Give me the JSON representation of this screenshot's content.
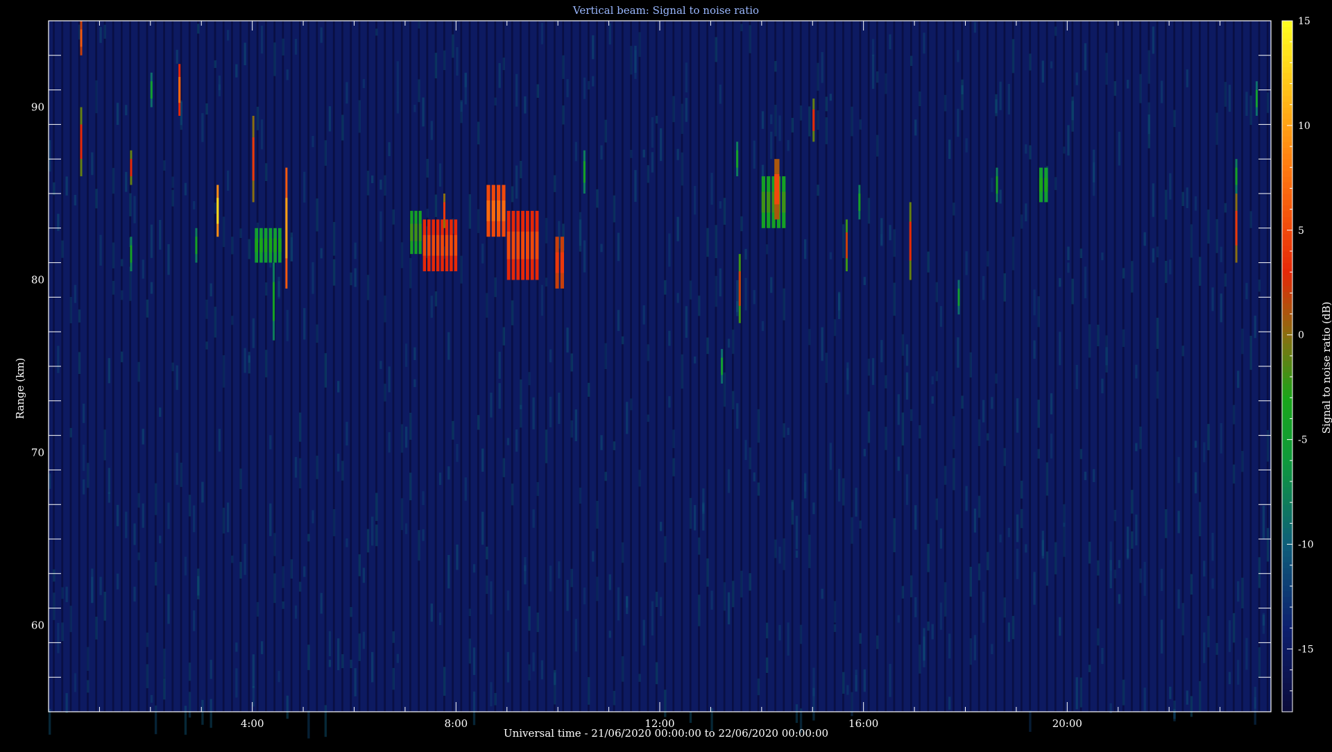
{
  "chart_data": {
    "type": "heatmap",
    "title": "Vertical beam: Signal to noise ratio",
    "xlabel": "Universal time - 21/06/2020 00:00:00 to 22/06/2020 00:00:00",
    "ylabel": "Range (km)",
    "colorbar_label": "Signal to noise ratio (dB)",
    "x_unit": "hours UT",
    "xlim": [
      0,
      24
    ],
    "ylim": [
      55,
      95
    ],
    "clim": [
      -18,
      15
    ],
    "x_ticks": [
      {
        "value": 4,
        "label": "4:00"
      },
      {
        "value": 8,
        "label": "8:00"
      },
      {
        "value": 12,
        "label": "12:00"
      },
      {
        "value": 16,
        "label": "16:00"
      },
      {
        "value": 20,
        "label": "20:00"
      }
    ],
    "y_ticks": [
      {
        "value": 60,
        "label": "60"
      },
      {
        "value": 70,
        "label": "70"
      },
      {
        "value": 80,
        "label": "80"
      },
      {
        "value": 90,
        "label": "90"
      }
    ],
    "colorbar_ticks": [
      {
        "value": 15,
        "label": "15"
      },
      {
        "value": 10,
        "label": "10"
      },
      {
        "value": 5,
        "label": "5"
      },
      {
        "value": 0,
        "label": "0"
      },
      {
        "value": -5,
        "label": "-5"
      },
      {
        "value": -10,
        "label": "-10"
      },
      {
        "value": -15,
        "label": "-15"
      }
    ],
    "colormap": [
      {
        "value": -18,
        "color": "#0b0b3a"
      },
      {
        "value": -14,
        "color": "#0d1f6e"
      },
      {
        "value": -10,
        "color": "#0e5e7a"
      },
      {
        "value": -6,
        "color": "#0f9a3c"
      },
      {
        "value": -3,
        "color": "#1aa51a"
      },
      {
        "value": 0,
        "color": "#8a6e10"
      },
      {
        "value": 3,
        "color": "#e62808"
      },
      {
        "value": 8,
        "color": "#ff7a10"
      },
      {
        "value": 15,
        "color": "#ffff20"
      }
    ],
    "echo_events": [
      {
        "t0": 0.62,
        "t1": 0.65,
        "r0": 86,
        "r1": 90,
        "snr": 3
      },
      {
        "t0": 0.62,
        "t1": 0.65,
        "r0": 93,
        "r1": 95,
        "snr": 6
      },
      {
        "t0": 1.6,
        "t1": 1.63,
        "r0": 85.5,
        "r1": 87.5,
        "snr": 3
      },
      {
        "t0": 1.6,
        "t1": 1.63,
        "r0": 80.5,
        "r1": 82.5,
        "snr": -4
      },
      {
        "t0": 2.0,
        "t1": 2.03,
        "r0": 90,
        "r1": 92,
        "snr": -5
      },
      {
        "t0": 2.55,
        "t1": 2.58,
        "r0": 89.5,
        "r1": 92.5,
        "snr": 7
      },
      {
        "t0": 2.88,
        "t1": 2.91,
        "r0": 81,
        "r1": 83,
        "snr": -4
      },
      {
        "t0": 3.3,
        "t1": 3.33,
        "r0": 82.5,
        "r1": 85.5,
        "snr": 13
      },
      {
        "t0": 4.0,
        "t1": 4.03,
        "r0": 84.5,
        "r1": 89.5,
        "snr": 4
      },
      {
        "t0": 4.05,
        "t1": 4.6,
        "r0": 81,
        "r1": 83,
        "snr": -5
      },
      {
        "t0": 4.4,
        "t1": 4.43,
        "r0": 76.5,
        "r1": 81,
        "snr": -4
      },
      {
        "t0": 4.65,
        "t1": 4.68,
        "r0": 79.5,
        "r1": 86.5,
        "snr": 10
      },
      {
        "t0": 7.1,
        "t1": 7.35,
        "r0": 81.5,
        "r1": 84,
        "snr": -4
      },
      {
        "t0": 7.35,
        "t1": 8.05,
        "r0": 80.5,
        "r1": 83.5,
        "snr": 3
      },
      {
        "t0": 7.75,
        "t1": 7.78,
        "r0": 83,
        "r1": 85,
        "snr": 4
      },
      {
        "t0": 8.6,
        "t1": 9.0,
        "r0": 82.5,
        "r1": 85.5,
        "snr": 5
      },
      {
        "t0": 9.0,
        "t1": 9.65,
        "r0": 80,
        "r1": 84,
        "snr": 3
      },
      {
        "t0": 9.95,
        "t1": 10.15,
        "r0": 79.5,
        "r1": 82.5,
        "snr": 2
      },
      {
        "t0": 10.5,
        "t1": 10.53,
        "r0": 85,
        "r1": 87.5,
        "snr": -4
      },
      {
        "t0": 13.2,
        "t1": 13.23,
        "r0": 74,
        "r1": 76,
        "snr": -5
      },
      {
        "t0": 13.55,
        "t1": 13.58,
        "r0": 77.5,
        "r1": 81.5,
        "snr": 2
      },
      {
        "t0": 13.5,
        "t1": 13.53,
        "r0": 86,
        "r1": 88,
        "snr": -4
      },
      {
        "t0": 14.0,
        "t1": 14.5,
        "r0": 83,
        "r1": 86,
        "snr": -4
      },
      {
        "t0": 14.25,
        "t1": 14.35,
        "r0": 83.5,
        "r1": 87,
        "snr": 5
      },
      {
        "t0": 15.0,
        "t1": 15.03,
        "r0": 88,
        "r1": 90.5,
        "snr": 3
      },
      {
        "t0": 15.65,
        "t1": 15.68,
        "r0": 80.5,
        "r1": 83.5,
        "snr": 2
      },
      {
        "t0": 15.9,
        "t1": 15.93,
        "r0": 83.5,
        "r1": 85.5,
        "snr": -4
      },
      {
        "t0": 16.9,
        "t1": 16.93,
        "r0": 80,
        "r1": 84.5,
        "snr": 3
      },
      {
        "t0": 17.85,
        "t1": 17.88,
        "r0": 78,
        "r1": 80,
        "snr": -5
      },
      {
        "t0": 18.6,
        "t1": 18.63,
        "r0": 84.5,
        "r1": 86.5,
        "snr": -4
      },
      {
        "t0": 19.45,
        "t1": 19.65,
        "r0": 84.5,
        "r1": 86.5,
        "snr": -5
      },
      {
        "t0": 23.3,
        "t1": 23.33,
        "r0": 81,
        "r1": 85,
        "snr": 4
      },
      {
        "t0": 23.3,
        "t1": 23.33,
        "r0": 85,
        "r1": 87,
        "snr": -4
      },
      {
        "t0": 23.7,
        "t1": 23.73,
        "r0": 89.5,
        "r1": 91.5,
        "snr": -5
      }
    ]
  }
}
